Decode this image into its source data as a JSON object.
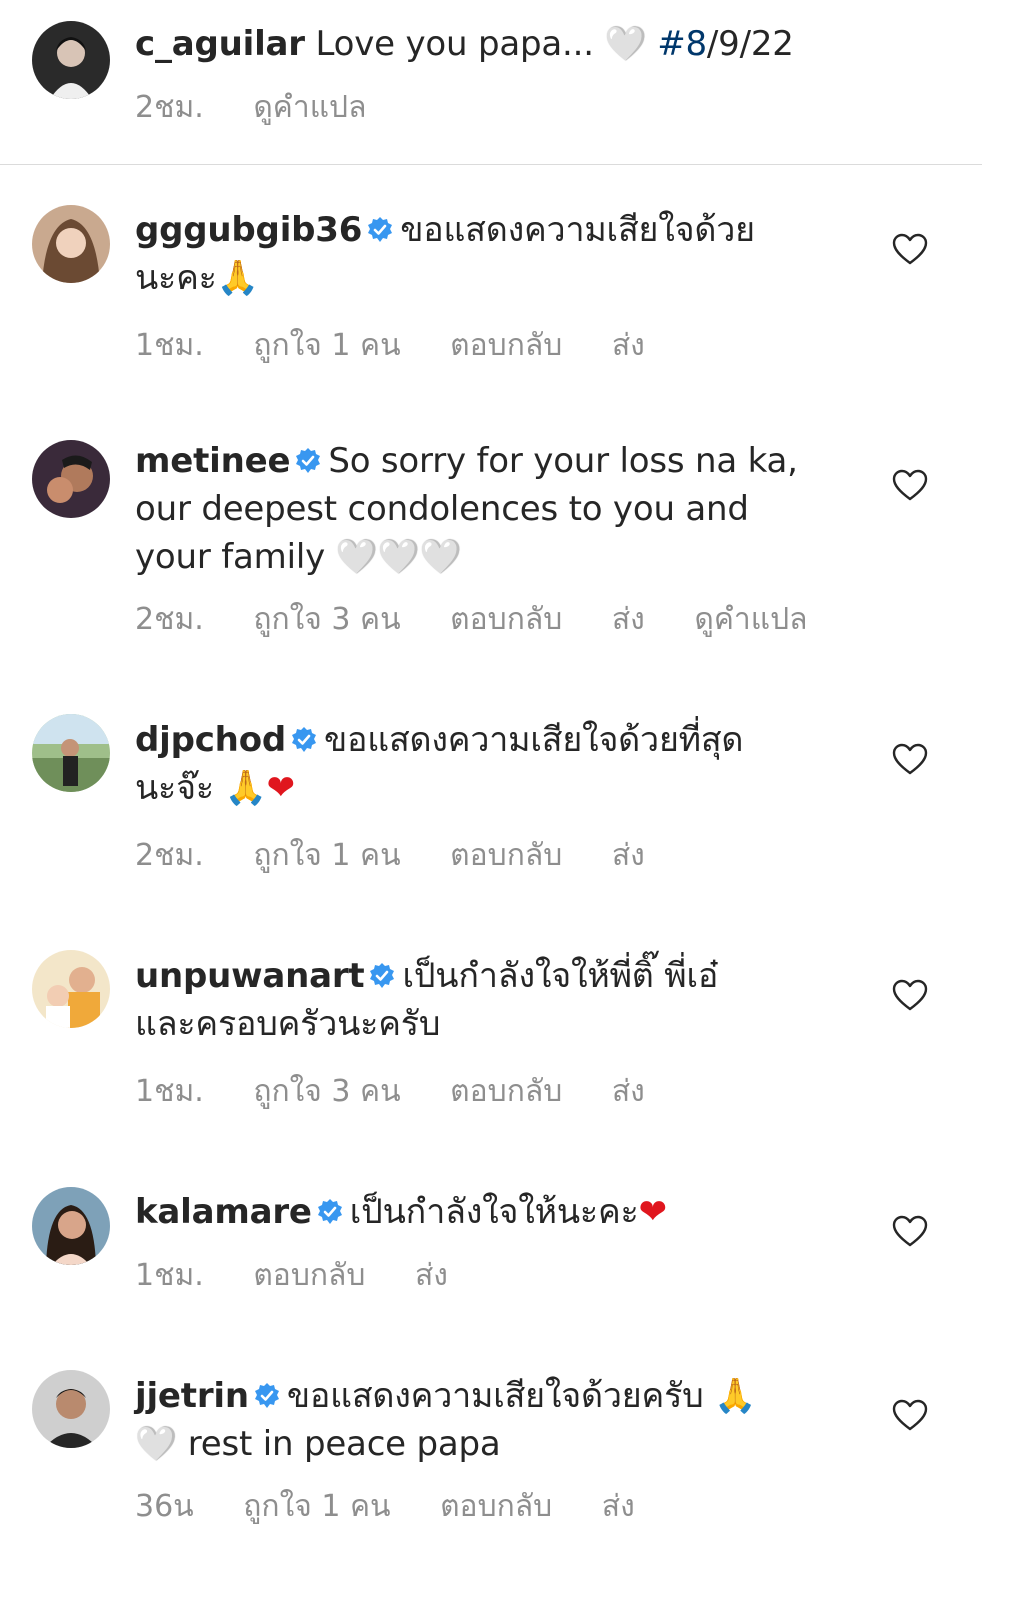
{
  "caption": {
    "username": "c_aguilar",
    "text": "Love you papa...",
    "emoji": "🤍",
    "hashtag": "#8",
    "date_rest": "/9/22",
    "time": "2ชม.",
    "translate": "ดูคำแปล"
  },
  "labels": {
    "reply": "ตอบกลับ",
    "send": "ส่ง",
    "translate": "ดูคำแปล"
  },
  "comments": [
    {
      "username": "gggubgib36",
      "verified": true,
      "line1": "ขอแสดงความเสียใจด้วย",
      "line2": "นะคะ",
      "emoji_line2": "🙏",
      "time": "1ชม.",
      "likes": "ถูกใจ 1 คน"
    },
    {
      "username": "metinee",
      "verified": true,
      "line1": "So sorry for your loss na ka,",
      "line2": "our deepest condolences to you and",
      "line3": "your family",
      "emoji_line3": "🤍🤍🤍",
      "time": "2ชม.",
      "likes": "ถูกใจ 3 คน"
    },
    {
      "username": "djpchod",
      "verified": true,
      "line1": "ขอแสดงความเสียใจด้วยที่สุด",
      "line2": "นะจ๊ะ",
      "emoji_line2a": "🙏",
      "emoji_line2b": "❤",
      "time": "2ชม.",
      "likes": "ถูกใจ 1 คน"
    },
    {
      "username": "unpuwanart",
      "verified": true,
      "line1": "เป็นกำลังใจให้พี่ติ๊ พี่เอ๋",
      "line2": "และครอบครัวนะครับ",
      "time": "1ชม.",
      "likes": "ถูกใจ 3 คน"
    },
    {
      "username": "kalamare",
      "verified": true,
      "line1": "เป็นกำลังใจให้นะคะ",
      "emoji_line1": "❤",
      "time": "1ชม."
    },
    {
      "username": "jjetrin",
      "verified": true,
      "line1": "ขอแสดงความเสียใจด้วยครับ",
      "emoji_line1": "🙏",
      "emoji_line2": "🤍",
      "line2": "rest in peace papa",
      "time": "36น",
      "likes": "ถูกใจ 1 คน"
    }
  ],
  "icons": {
    "verified": "verified-badge-icon",
    "like": "heart-outline-icon"
  },
  "colors": {
    "verified": "#3897f0",
    "meta": "#8e8e8e",
    "hashtag": "#00376b",
    "divider": "#dbdbdb"
  }
}
